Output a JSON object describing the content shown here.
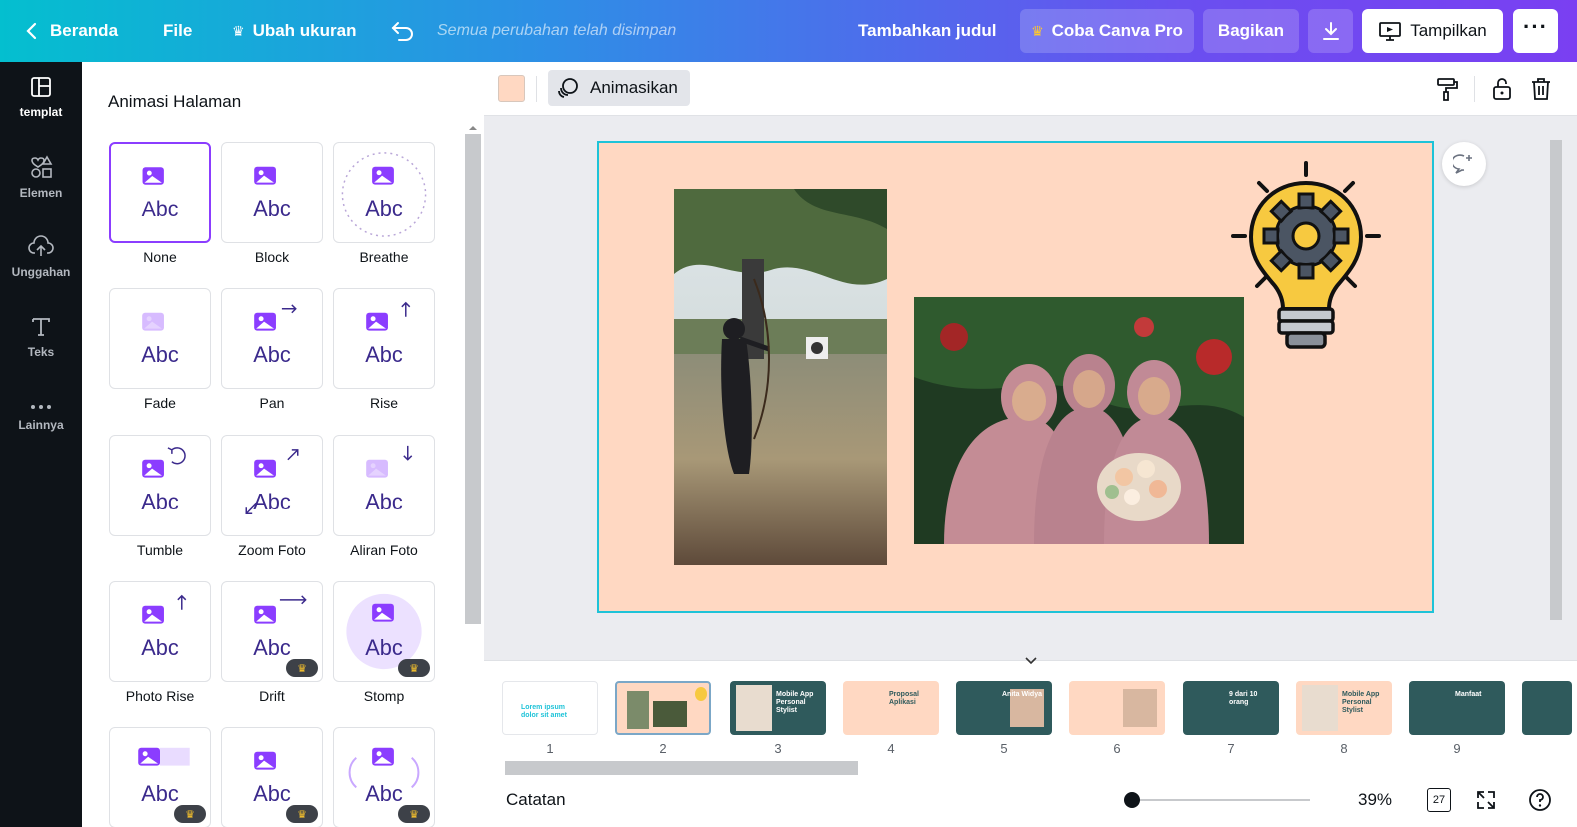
{
  "topbar": {
    "home_label": "Beranda",
    "file_label": "File",
    "resize_label": "Ubah ukuran",
    "saved_status": "Semua perubahan telah disimpan",
    "add_title_label": "Tambahkan judul",
    "try_pro_label": "Coba Canva Pro",
    "share_label": "Bagikan",
    "present_label": "Tampilkan"
  },
  "rail": {
    "items": [
      {
        "label": "templat",
        "icon": "layout-icon"
      },
      {
        "label": "Elemen",
        "icon": "shapes-icon"
      },
      {
        "label": "Unggahan",
        "icon": "cloud-upload-icon"
      },
      {
        "label": "Teks",
        "icon": "text-icon"
      },
      {
        "label": "Lainnya",
        "icon": "more-icon"
      }
    ]
  },
  "panel": {
    "title": "Animasi Halaman",
    "card_text": "Abc",
    "animations": [
      {
        "label": "None",
        "pro": false
      },
      {
        "label": "Block",
        "pro": false
      },
      {
        "label": "Breathe",
        "pro": false
      },
      {
        "label": "Fade",
        "pro": false
      },
      {
        "label": "Pan",
        "pro": false
      },
      {
        "label": "Rise",
        "pro": false
      },
      {
        "label": "Tumble",
        "pro": false
      },
      {
        "label": "Zoom Foto",
        "pro": false
      },
      {
        "label": "Aliran Foto",
        "pro": false
      },
      {
        "label": "Photo Rise",
        "pro": false
      },
      {
        "label": "Drift",
        "pro": true
      },
      {
        "label": "Stomp",
        "pro": true
      },
      {
        "label": "",
        "pro": true
      },
      {
        "label": "",
        "pro": true
      },
      {
        "label": "",
        "pro": true
      }
    ]
  },
  "editor": {
    "animate_label": "Animasikan",
    "page_color": "#ffd8c2"
  },
  "filmstrip": {
    "pages": [
      {
        "num": "1",
        "text": "Lorem ipsum dolor sit amet"
      },
      {
        "num": "2",
        "text": ""
      },
      {
        "num": "3",
        "text": "Mobile App Personal Stylist"
      },
      {
        "num": "4",
        "text": "Proposal Aplikasi"
      },
      {
        "num": "5",
        "text": "Anita Widya"
      },
      {
        "num": "6",
        "text": ""
      },
      {
        "num": "7",
        "text": "9 dari 10 orang"
      },
      {
        "num": "8",
        "text": "Mobile App Personal Stylist"
      },
      {
        "num": "9",
        "text": "Manfaat"
      }
    ]
  },
  "bottombar": {
    "notes_label": "Catatan",
    "zoom": "39%",
    "page_count": "27"
  },
  "colors": {
    "accent": "#8b3dff",
    "selection": "#1ec3d8",
    "dark_slide": "#2f5a5c",
    "peach": "#ffd8c2"
  }
}
